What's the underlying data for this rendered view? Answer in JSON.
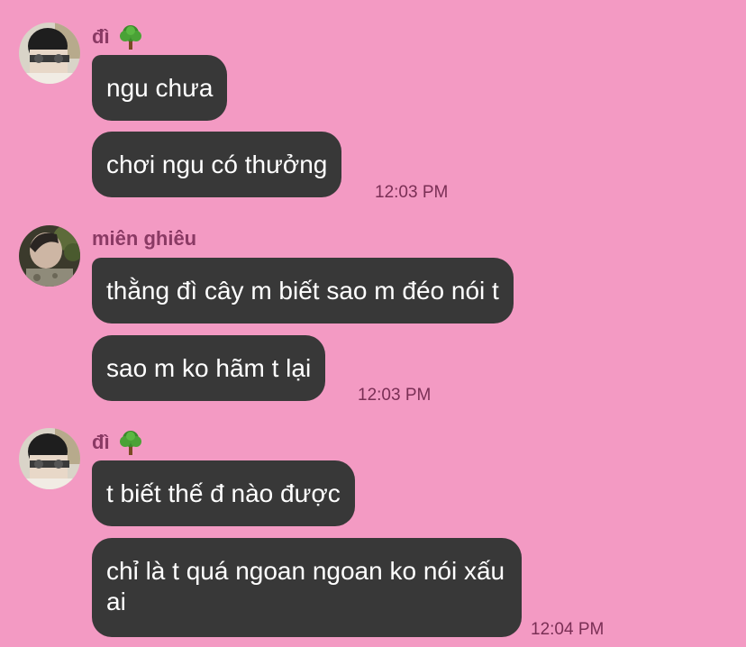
{
  "colors": {
    "background": "#f39ac3",
    "bubble": "#383838",
    "bubble_text": "#ffffff",
    "sender_name": "#8a3a64",
    "timestamp": "#7a2f55"
  },
  "groups": [
    {
      "sender": "đì",
      "sender_emoji_icon": "tree-icon",
      "messages": [
        "ngu chưa",
        "chơi ngu có thưởng"
      ],
      "time": "12:03 PM"
    },
    {
      "sender": "miên ghiêu",
      "messages": [
        "thằng đì cây m biết sao m đéo nói t",
        "sao m ko hãm t lại"
      ],
      "time": "12:03 PM"
    },
    {
      "sender": "đì",
      "sender_emoji_icon": "tree-icon",
      "messages": [
        "t biết thế đ nào được",
        "chỉ là t quá ngoan ngoan ko nói xấu ai"
      ],
      "time": "12:04 PM"
    }
  ]
}
